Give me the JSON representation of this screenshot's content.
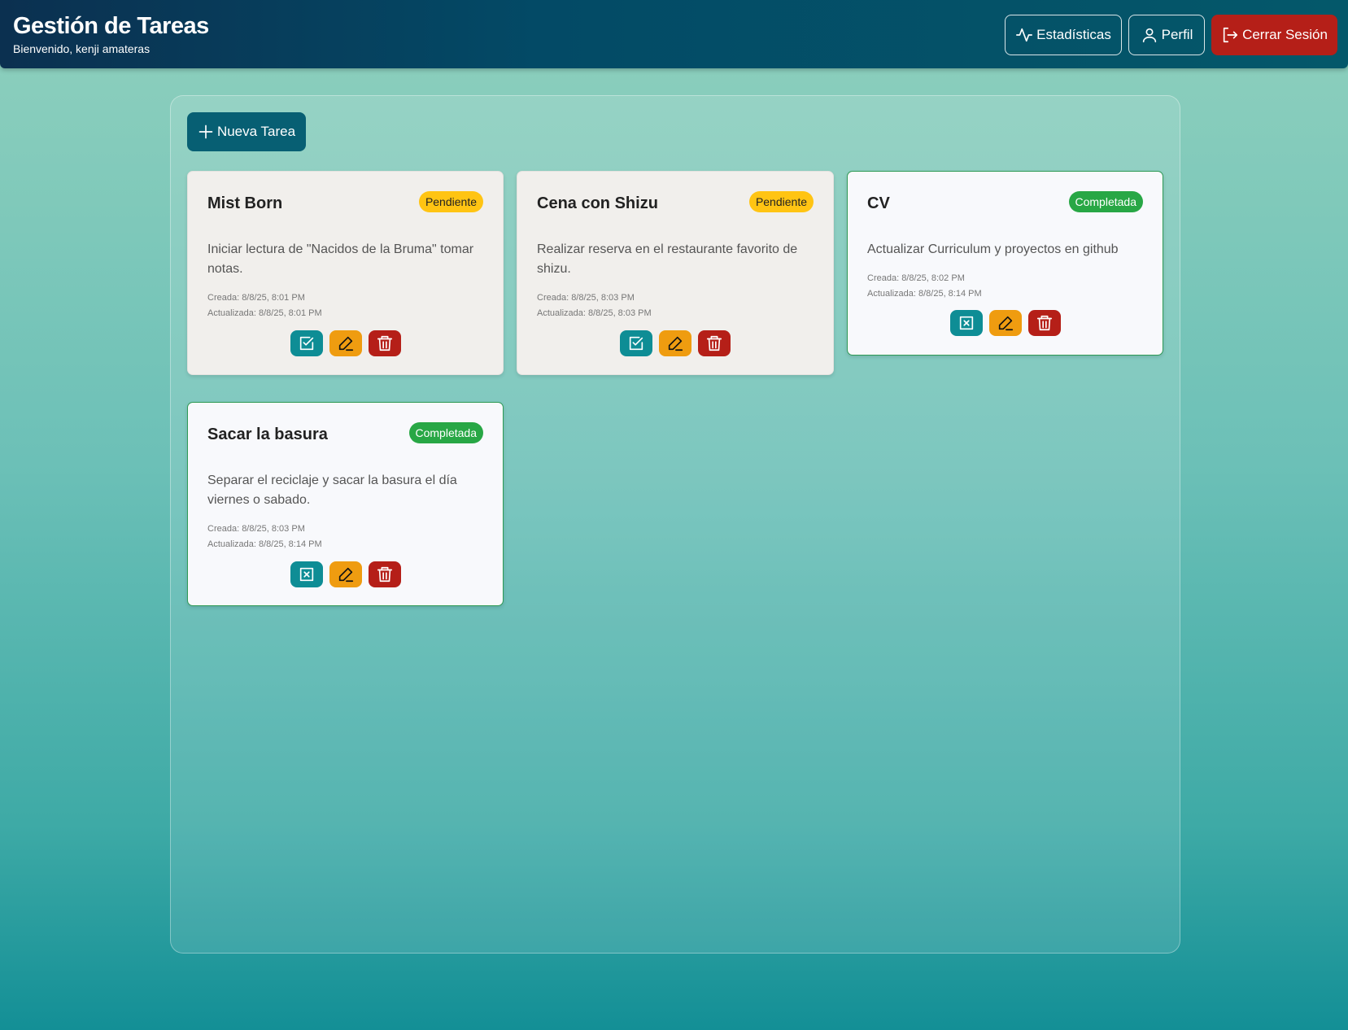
{
  "header": {
    "title": "Gestión de Tareas",
    "welcome": "Bienvenido, kenji amateras",
    "stats_label": "Estadísticas",
    "profile_label": "Perfil",
    "logout_label": "Cerrar Sesión"
  },
  "toolbar": {
    "new_task_label": "Nueva Tarea"
  },
  "colors": {
    "pending_badge": "#ffc413",
    "completed_badge": "#28a745",
    "toggle_button": "#0e8d95",
    "edit_button": "#ef9c10",
    "delete_button": "#b51f18"
  },
  "tasks": [
    {
      "title": "Mist Born",
      "status": "Pendiente",
      "description": "Iniciar lectura de \"Nacidos de la Bruma\" tomar notas.",
      "created": "Creada: 8/8/25, 8:01 PM",
      "updated": "Actualizada: 8/8/25, 8:01 PM",
      "toggle_icon": "check-square-icon"
    },
    {
      "title": "Cena con Shizu",
      "status": "Pendiente",
      "description": "Realizar reserva en el restaurante favorito de shizu.",
      "created": "Creada: 8/8/25, 8:03 PM",
      "updated": "Actualizada: 8/8/25, 8:03 PM",
      "toggle_icon": "check-square-icon"
    },
    {
      "title": "CV",
      "status": "Completada",
      "description": "Actualizar Curriculum y proyectos en github",
      "created": "Creada: 8/8/25, 8:02 PM",
      "updated": "Actualizada: 8/8/25, 8:14 PM",
      "toggle_icon": "x-square-icon"
    },
    {
      "title": "Sacar la basura",
      "status": "Completada",
      "description": "Separar el reciclaje y sacar la basura el día viernes o sabado.",
      "created": "Creada: 8/8/25, 8:03 PM",
      "updated": "Actualizada: 8/8/25, 8:14 PM",
      "toggle_icon": "x-square-icon"
    }
  ]
}
